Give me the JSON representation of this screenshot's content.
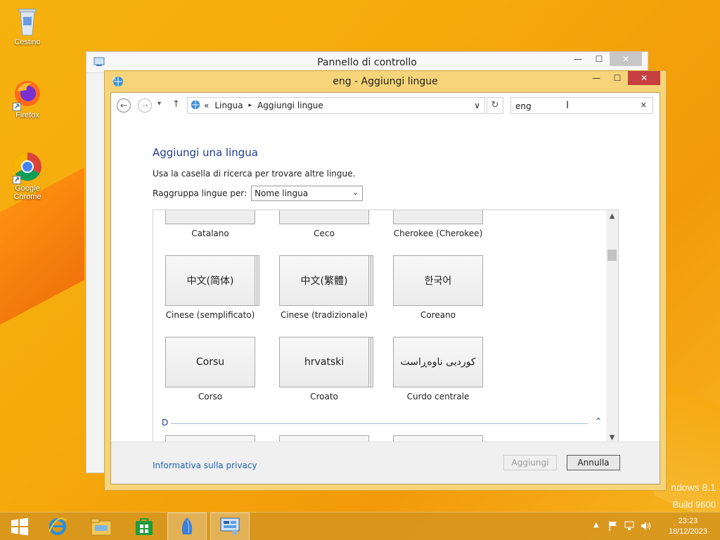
{
  "desktop": {
    "icons": [
      {
        "label": "Cestino",
        "icon": "recycle-bin-icon"
      },
      {
        "label": "Firefox",
        "icon": "firefox-icon"
      },
      {
        "label": "Google Chrome",
        "icon": "chrome-icon"
      }
    ],
    "watermark": {
      "line1": "ndows 8.1",
      "line2": "Build 9600"
    }
  },
  "back_window": {
    "title": "Pannello di controllo"
  },
  "window": {
    "title": "eng - Aggiungi lingue",
    "controls": {
      "minimize": "—",
      "maximize": "☐",
      "close": "✕"
    },
    "nav": {
      "back": "←",
      "forward": "→",
      "recent": "▾",
      "up": "↑",
      "breadcrumb_prefix": "«",
      "breadcrumb": [
        "Lingua",
        "Aggiungi lingue"
      ],
      "refresh": "↻",
      "dropdown": "∨"
    },
    "search": {
      "value": "eng",
      "clear": "✕"
    },
    "heading": "Aggiungi una lingua",
    "hint": "Usa la casella di ricerca per trovare altre lingue.",
    "group": {
      "label": "Raggruppa lingue per:",
      "selected": "Nome lingua"
    },
    "top_partial_labels": [
      "Catalano",
      "Ceco",
      "Cherokee (Cherokee)"
    ],
    "languages": [
      {
        "native": "中文(简体)",
        "label": "Cinese (semplificato)",
        "stacked": true
      },
      {
        "native": "中文(繁體)",
        "label": "Cinese (tradizionale)",
        "stacked": true
      },
      {
        "native": "한국어",
        "label": "Coreano",
        "stacked": false
      },
      {
        "native": "Corsu",
        "label": "Corso",
        "stacked": false
      },
      {
        "native": "hrvatski",
        "label": "Croato",
        "stacked": true
      },
      {
        "native": "کوردیی ناوەڕاست",
        "label": "Curdo centrale",
        "stacked": false
      }
    ],
    "section_letter": "D",
    "footer": {
      "privacy": "Informativa sulla privacy",
      "add": "Aggiungi",
      "cancel": "Annulla"
    }
  },
  "taskbar": {
    "clock_time": "23:23",
    "clock_date": "18/12/2023",
    "items": [
      "start-button",
      "internet-explorer-icon",
      "file-explorer-icon",
      "store-icon",
      "language-app-icon",
      "control-panel-icon"
    ]
  }
}
